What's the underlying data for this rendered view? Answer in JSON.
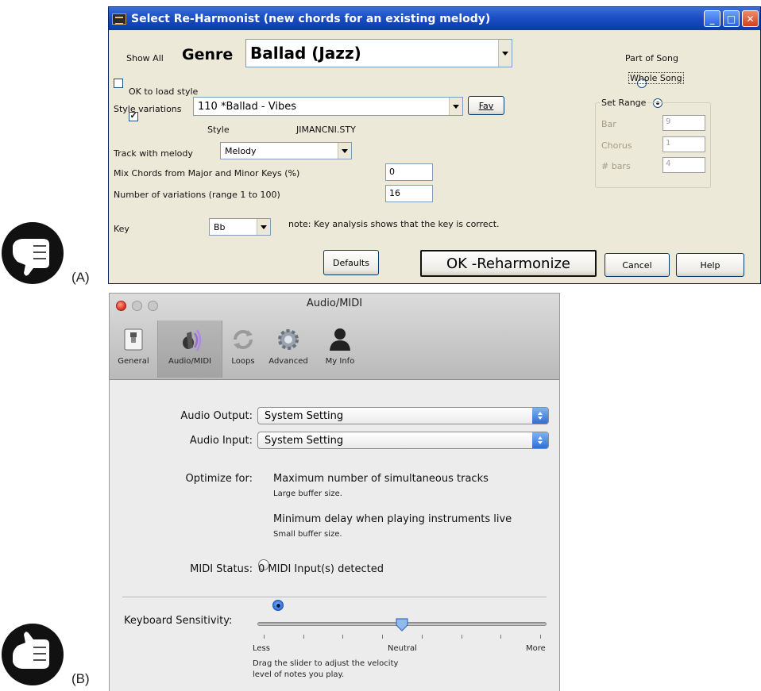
{
  "figure_labels": {
    "a": "(A)",
    "b": "(B)"
  },
  "icons": {
    "thumb_a": "thumbs-down-icon",
    "thumb_b": "thumbs-up-icon"
  },
  "window_a": {
    "title": "Select Re-Harmonist (new chords for an existing melody)",
    "show_all_label": "Show All",
    "genre_label": "Genre",
    "genre_value": "Ballad (Jazz)",
    "ok_to_load_label": "OK to load style",
    "style_variations_label": "Style variations",
    "style_variations_value": "110 *Ballad - Vibes",
    "fav_label": "Fav",
    "style_label": "Style",
    "style_file": "JIMANCNI.STY",
    "track_label": "Track with melody",
    "track_value": "Melody",
    "mix_label": "Mix Chords from Major and Minor Keys (%)",
    "mix_value": "0",
    "num_variations_label": "Number of variations (range 1 to 100)",
    "num_variations_value": "16",
    "key_label": "Key",
    "key_value": "Bb",
    "key_note": "note: Key analysis shows that the key is correct.",
    "part_of_song_label": "Part of Song",
    "whole_song_label": "Whole Song",
    "set_range_label": "Set Range",
    "bar_label": "Bar",
    "bar_value": "9",
    "chorus_label": "Chorus",
    "chorus_value": "1",
    "bars_label": "# bars",
    "bars_value": "4",
    "defaults_label": "Defaults",
    "ok_label": "OK -Reharmonize",
    "cancel_label": "Cancel",
    "help_label": "Help"
  },
  "window_b": {
    "title": "Audio/MIDI",
    "toolbar": [
      "General",
      "Audio/MIDI",
      "Loops",
      "Advanced",
      "My Info"
    ],
    "audio_output_label": "Audio Output:",
    "audio_output_value": "System Setting",
    "audio_input_label": "Audio Input:",
    "audio_input_value": "System Setting",
    "optimize_label": "Optimize for:",
    "opt1_label": "Maximum number of simultaneous tracks",
    "opt1_sub": "Large buffer size.",
    "opt2_label": "Minimum delay when playing instruments live",
    "opt2_sub": "Small buffer size.",
    "midi_status_label": "MIDI Status:",
    "midi_status_value": "0 MIDI Input(s) detected",
    "sensitivity_label": "Keyboard Sensitivity:",
    "sensitivity_value": 0.5,
    "less_label": "Less",
    "neutral_label": "Neutral",
    "more_label": "More",
    "slider_help_1": "Drag the slider to adjust the velocity",
    "slider_help_2": "level of notes you play."
  }
}
